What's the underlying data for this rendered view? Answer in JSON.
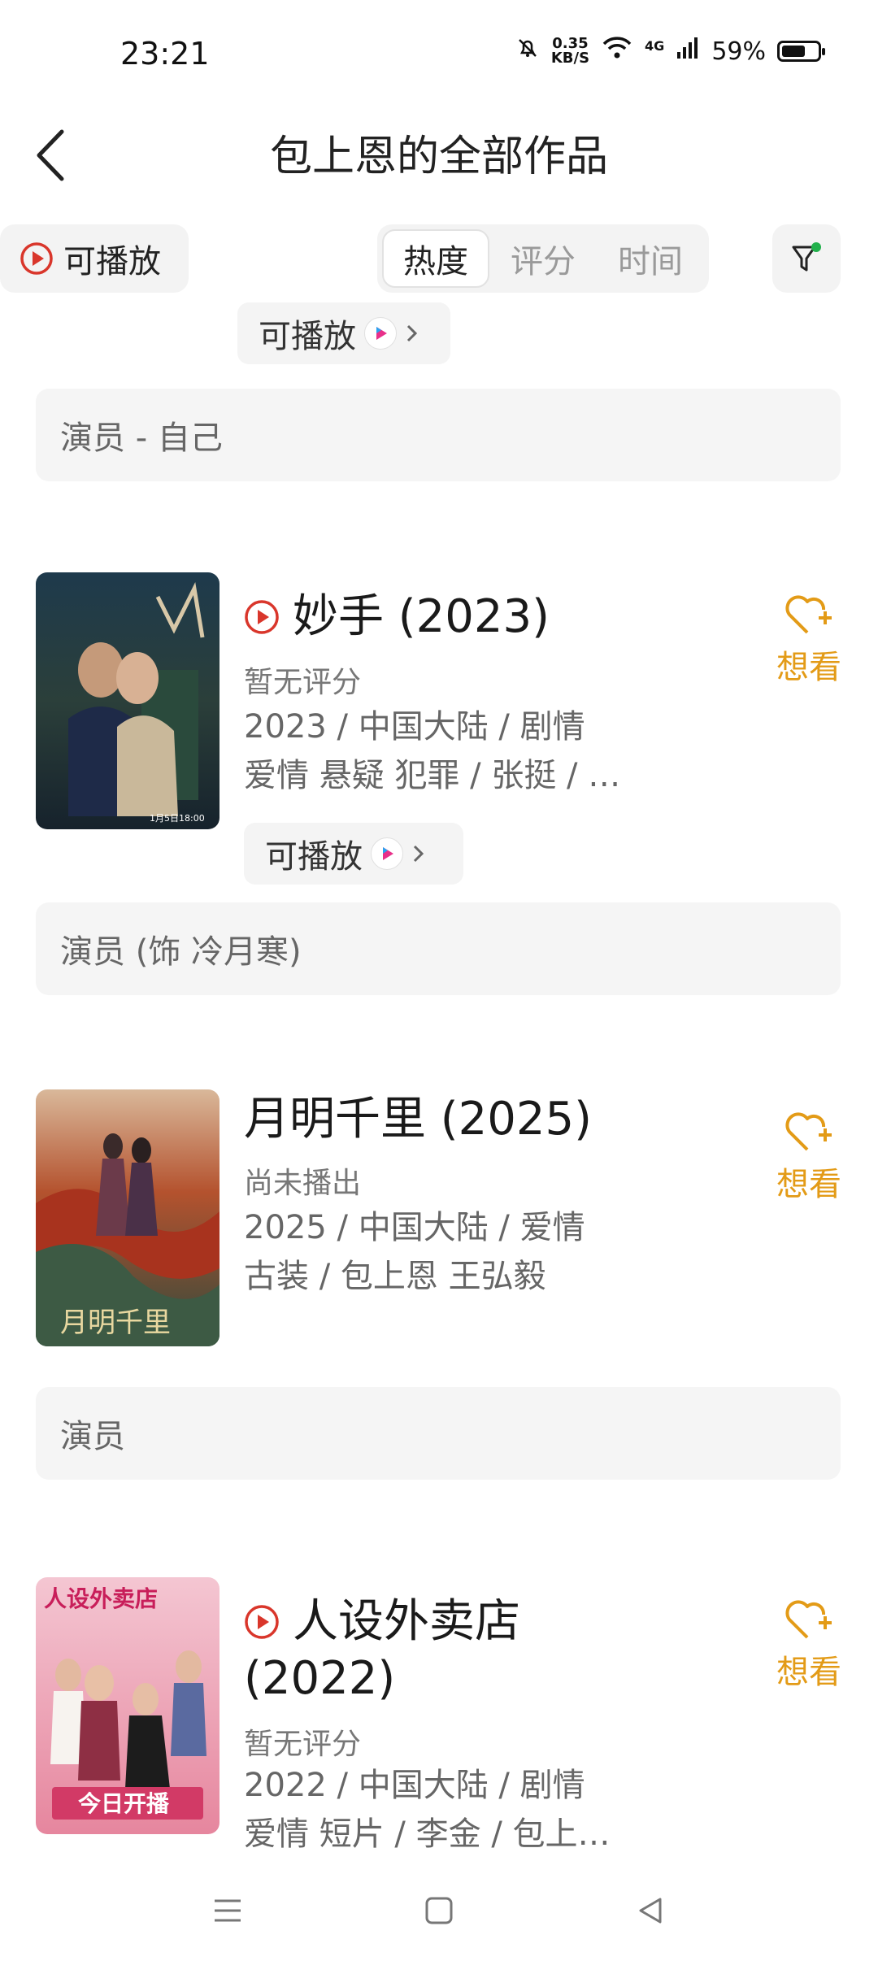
{
  "status": {
    "time": "23:21",
    "net_speed_value": "0.35",
    "net_speed_unit": "KB/S",
    "network": "4G",
    "battery": "59%",
    "battery_level": 0.59
  },
  "header": {
    "title": "包上恩的全部作品"
  },
  "filters": {
    "playable_label": "可播放",
    "sort_tabs": [
      "热度",
      "评分",
      "时间"
    ],
    "active_sort": "热度"
  },
  "partial_item": {
    "playable_label": "可播放",
    "role": "演员 - 自己"
  },
  "works": [
    {
      "title": "妙手 (2023)",
      "rating_text": "暂无评分",
      "meta_line1": "2023 / 中国大陆 / 剧情",
      "meta_line2": "爱情 悬疑 犯罪 / 张挺 / …",
      "playable_label": "可播放",
      "want_label": "想看",
      "role": "演员 (饰 冷月寒)",
      "poster_text": "1月5日18:00"
    },
    {
      "title": "月明千里 (2025)",
      "rating_text": "尚未播出",
      "meta_line1": "2025 / 中国大陆 / 爱情",
      "meta_line2": "古装 / 包上恩 王弘毅",
      "want_label": "想看",
      "role": "演员",
      "poster_text": "月明千里"
    },
    {
      "title_line1": "人设外卖店",
      "title_line2": "(2022)",
      "rating_text": "暂无评分",
      "meta_line1": "2022 / 中国大陆 / 剧情",
      "meta_line2": "爱情 短片 / 李金 / 包上…",
      "want_label": "想看",
      "poster_title": "人设外卖店",
      "poster_text": "今日开播"
    }
  ],
  "colors": {
    "accent_red": "#d9362b",
    "want_orange": "#e39b17",
    "pill_bg": "#f4f4f4",
    "filter_dot": "#22b14c"
  }
}
